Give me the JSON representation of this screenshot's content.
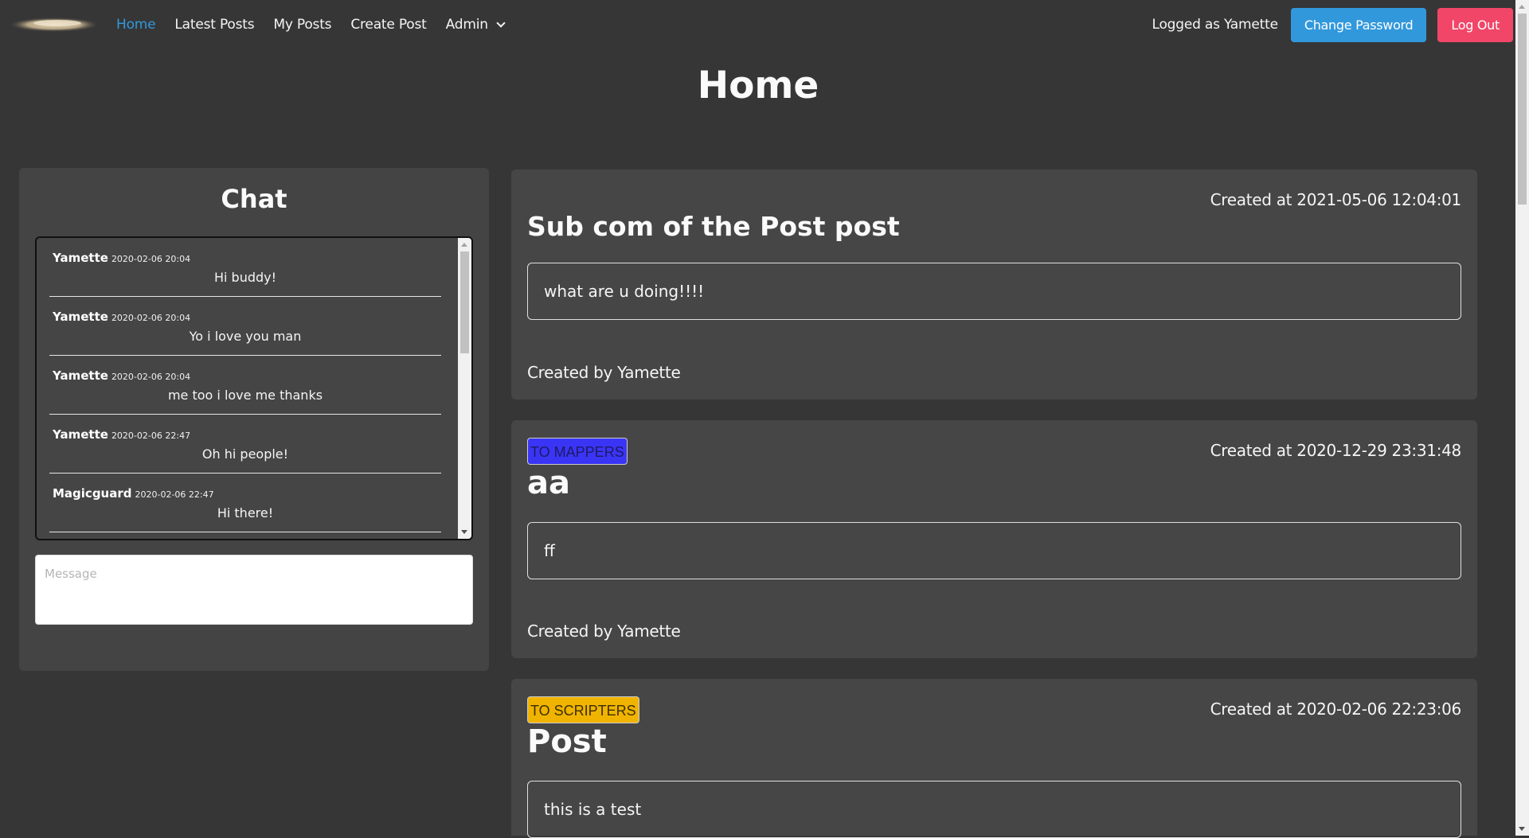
{
  "nav": {
    "logo_icon": "blurred-logo",
    "items": [
      {
        "label": "Home",
        "active": true
      },
      {
        "label": "Latest Posts"
      },
      {
        "label": "My Posts"
      },
      {
        "label": "Create Post"
      },
      {
        "label": "Admin"
      }
    ],
    "logged_as": "Logged as Yamette",
    "change_password": "Change Password",
    "logout": "Log Out"
  },
  "page": {
    "title": "Home"
  },
  "chat": {
    "title": "Chat",
    "messages": [
      {
        "author": "Yamette",
        "time": "2020-02-06 20:04",
        "text": "Hi buddy!"
      },
      {
        "author": "Yamette",
        "time": "2020-02-06 20:04",
        "text": "Yo i love you man"
      },
      {
        "author": "Yamette",
        "time": "2020-02-06 20:04",
        "text": "me too i love me thanks"
      },
      {
        "author": "Yamette",
        "time": "2020-02-06 22:47",
        "text": "Oh hi people!"
      },
      {
        "author": "Magicguard",
        "time": "2020-02-06 22:47",
        "text": "Hi there!"
      }
    ],
    "input_placeholder": "Message"
  },
  "posts": [
    {
      "tag": null,
      "created_at": "Created at 2021-05-06 12:04:01",
      "title": "Sub com of the Post post",
      "content": "what are u doing!!!!",
      "created_by": "Created by Yamette"
    },
    {
      "tag": {
        "label": "TO MAPPERS",
        "color": "#3a35f5",
        "text_color": "#1d1a66"
      },
      "created_at": "Created at 2020-12-29 23:31:48",
      "title": "aa",
      "content": "ff",
      "created_by": "Created by Yamette"
    },
    {
      "tag": {
        "label": "TO SCRIPTERS",
        "color": "#f0b400",
        "text_color": "#3d2f00"
      },
      "created_at": "Created at 2020-02-06 22:23:06",
      "title": "Post",
      "content": "this is a test",
      "created_by": ""
    }
  ],
  "colors": {
    "background": "#363636",
    "accent_blue": "#3298dc",
    "accent_pink": "#f14668"
  }
}
